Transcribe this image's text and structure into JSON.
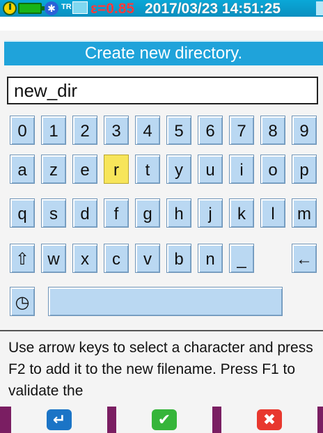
{
  "status": {
    "bt_glyph": "✱",
    "tr_label": "TR",
    "epsilon": "ε=0.85",
    "datetime": "2017/03/23 14:51:25"
  },
  "title": "Create new directory.",
  "filename_value": "new_dir",
  "keyboard": {
    "row1": [
      "0",
      "1",
      "2",
      "3",
      "4",
      "5",
      "6",
      "7",
      "8",
      "9"
    ],
    "row2": [
      "a",
      "z",
      "e",
      "r",
      "t",
      "y",
      "u",
      "i",
      "o",
      "p"
    ],
    "row3": [
      "q",
      "s",
      "d",
      "f",
      "g",
      "h",
      "j",
      "k",
      "l",
      "m"
    ],
    "row4": [
      "⇧",
      "w",
      "x",
      "c",
      "v",
      "b",
      "n",
      "_",
      "←"
    ],
    "clock_glyph": "◷",
    "selected_key": "r"
  },
  "help_text": "Use arrow keys to select a character and press F2 to add it to the new filename. Press F1 to validate the",
  "fkeys": {
    "enter_glyph": "↵",
    "check_glyph": "✔",
    "cross_glyph": "✖"
  }
}
